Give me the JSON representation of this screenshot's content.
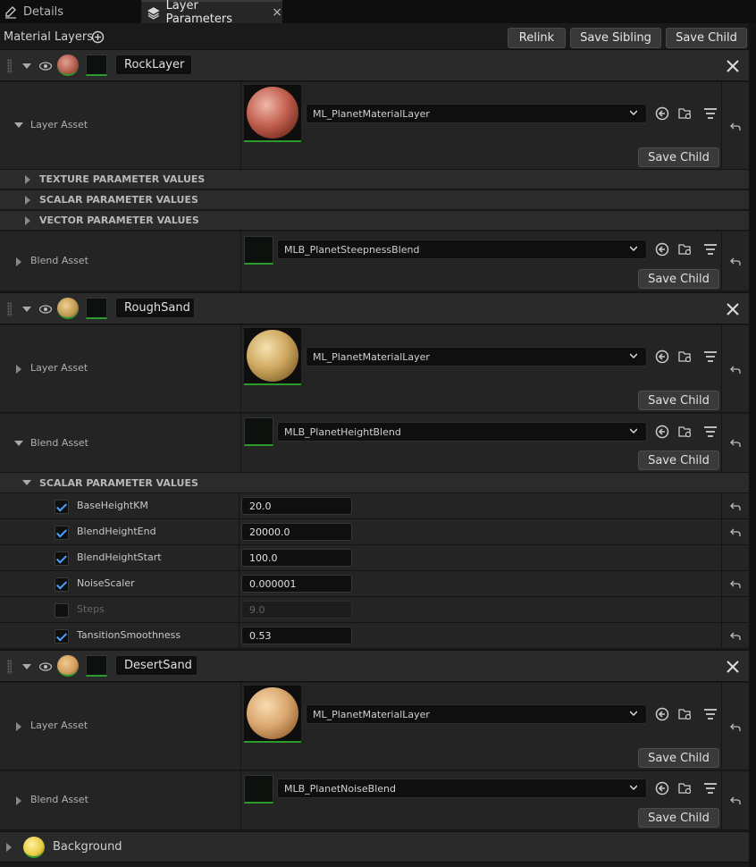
{
  "tabs": [
    {
      "label": "Details",
      "icon": "pencil-icon"
    },
    {
      "label": "Layer Parameters",
      "icon": "layers-icon",
      "close": "×"
    }
  ],
  "toolbar": {
    "title": "Material Layers",
    "relink": "Relink",
    "save_sibling": "Save Sibling",
    "save_child": "Save Child"
  },
  "colors": {
    "accent_green": "#2c9a2c",
    "check_blue": "#4aa3ff",
    "panel_bg": "#1a1a1a"
  },
  "layers": [
    {
      "name": "RockLayer",
      "layer_asset": {
        "label": "Layer Asset",
        "value": "ML_PlanetMaterialLayer",
        "save": "Save Child"
      },
      "categories": [
        "TEXTURE PARAMETER VALUES",
        "SCALAR PARAMETER VALUES",
        "VECTOR PARAMETER VALUES"
      ],
      "blend_asset": {
        "label": "Blend Asset",
        "value": "MLB_PlanetSteepnessBlend",
        "save": "Save Child"
      }
    },
    {
      "name": "RoughSand",
      "layer_asset": {
        "label": "Layer Asset",
        "value": "ML_PlanetMaterialLayer",
        "save": "Save Child"
      },
      "blend_asset": {
        "label": "Blend Asset",
        "value": "MLB_PlanetHeightBlend",
        "save": "Save Child"
      },
      "scalar_section": "SCALAR PARAMETER VALUES",
      "scalars": [
        {
          "name": "BaseHeightKM",
          "value": "20.0",
          "enabled": true
        },
        {
          "name": "BlendHeightEnd",
          "value": "20000.0",
          "enabled": true
        },
        {
          "name": "BlendHeightStart",
          "value": "100.0",
          "enabled": true
        },
        {
          "name": "NoiseScaler",
          "value": "0.000001",
          "enabled": true
        },
        {
          "name": "Steps",
          "value": "9.0",
          "enabled": false
        },
        {
          "name": "TansitionSmoothness",
          "value": "0.53",
          "enabled": true
        }
      ]
    },
    {
      "name": "DesertSand",
      "layer_asset": {
        "label": "Layer Asset",
        "value": "ML_PlanetMaterialLayer",
        "save": "Save Child"
      },
      "blend_asset": {
        "label": "Blend Asset",
        "value": "MLB_PlanetNoiseBlend",
        "save": "Save Child"
      }
    }
  ],
  "background": {
    "label": "Background"
  }
}
